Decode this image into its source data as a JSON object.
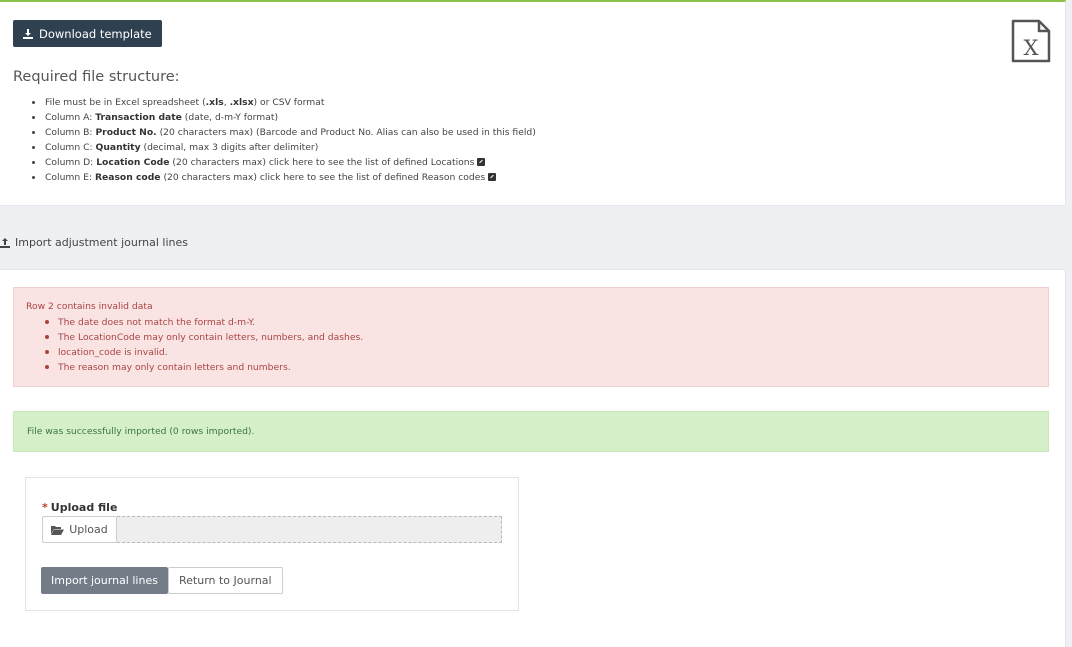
{
  "toolbar": {
    "download_label": "Download template"
  },
  "requirements": {
    "title": "Required file structure:",
    "items": [
      {
        "pre": "File must be in Excel spreadsheet (",
        "b1": ".xls",
        "mid": ", ",
        "b2": ".xlsx",
        "post": ") or CSV format"
      },
      {
        "pre": "Column A: ",
        "bold": "Transaction date",
        "post": " (date, d-m-Y format)"
      },
      {
        "pre": "Column B: ",
        "bold": "Product No.",
        "post": " (20 characters max) (Barcode and Product No. Alias can also be used in this field)"
      },
      {
        "pre": "Column C: ",
        "bold": "Quantity",
        "post": " (decimal, max 3 digits after delimiter)"
      },
      {
        "pre": "Column D: ",
        "bold": "Location Code",
        "post": " (20 characters max) click here to see the list of defined Locations"
      },
      {
        "pre": "Column E: ",
        "bold": "Reason code",
        "post": " (20 characters max) click here to see the list of defined Reason codes"
      }
    ]
  },
  "section": {
    "title": "Import adjustment journal lines"
  },
  "error_alert": {
    "title": "Row 2 contains invalid data",
    "items": [
      "The date does not match the format d-m-Y.",
      "The LocationCode may only contain letters, numbers, and dashes.",
      "location_code is invalid.",
      "The reason may only contain letters and numbers."
    ]
  },
  "success_alert": {
    "message": "File was successfully imported (0 rows imported)."
  },
  "upload": {
    "required_mark": "*",
    "label": "Upload file",
    "button_label": "Upload"
  },
  "actions": {
    "import_label": "Import journal lines",
    "return_label": "Return to Journal"
  },
  "icons": {
    "download": "download-icon",
    "excel": "excel-file-icon",
    "external_link": "external-link-icon",
    "upload_section": "upload-icon",
    "folder": "folder-open-icon"
  },
  "colors": {
    "primary_button": "#2f4050",
    "import_button": "#737c87",
    "error_bg": "#f9e4e3",
    "error_text": "#a94442",
    "success_bg": "#d5f0c8",
    "success_text": "#3c763d",
    "top_accent": "#8bc34a"
  }
}
